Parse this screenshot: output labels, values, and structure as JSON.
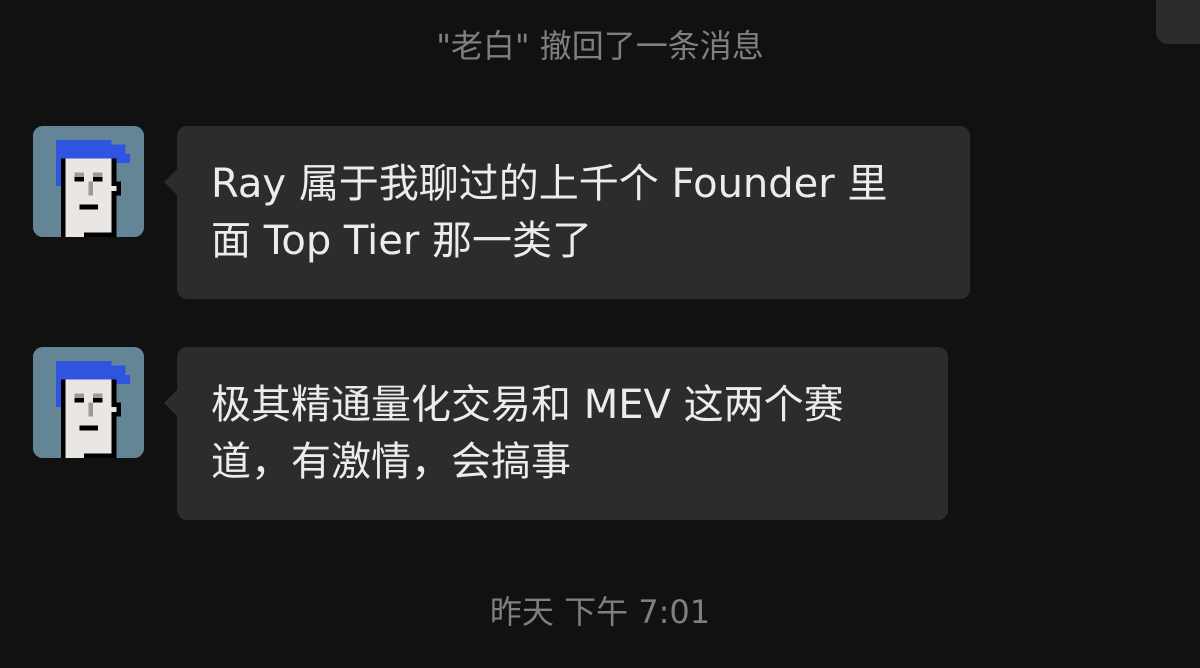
{
  "chat": {
    "recall_notice": "\"老白\" 撤回了一条消息",
    "messages": [
      {
        "avatar_icon": "pixel-punk-avatar-icon",
        "lines": [
          "Ray 属于我聊过的上千个 Founder 里",
          "面 Top Tier 那一类了"
        ]
      },
      {
        "avatar_icon": "pixel-punk-avatar-icon",
        "lines": [
          "极其精通量化交易和 MEV 这两个赛",
          "道，有激情，会搞事"
        ]
      }
    ],
    "timestamp": "昨天 下午 7:01"
  },
  "colors": {
    "background": "#111111",
    "bubble": "#2c2c2c",
    "bubble_text": "#ececec",
    "meta_text": "#7f7f7f",
    "avatar_bg": "#638596",
    "avatar_hair": "#2f55e0"
  }
}
